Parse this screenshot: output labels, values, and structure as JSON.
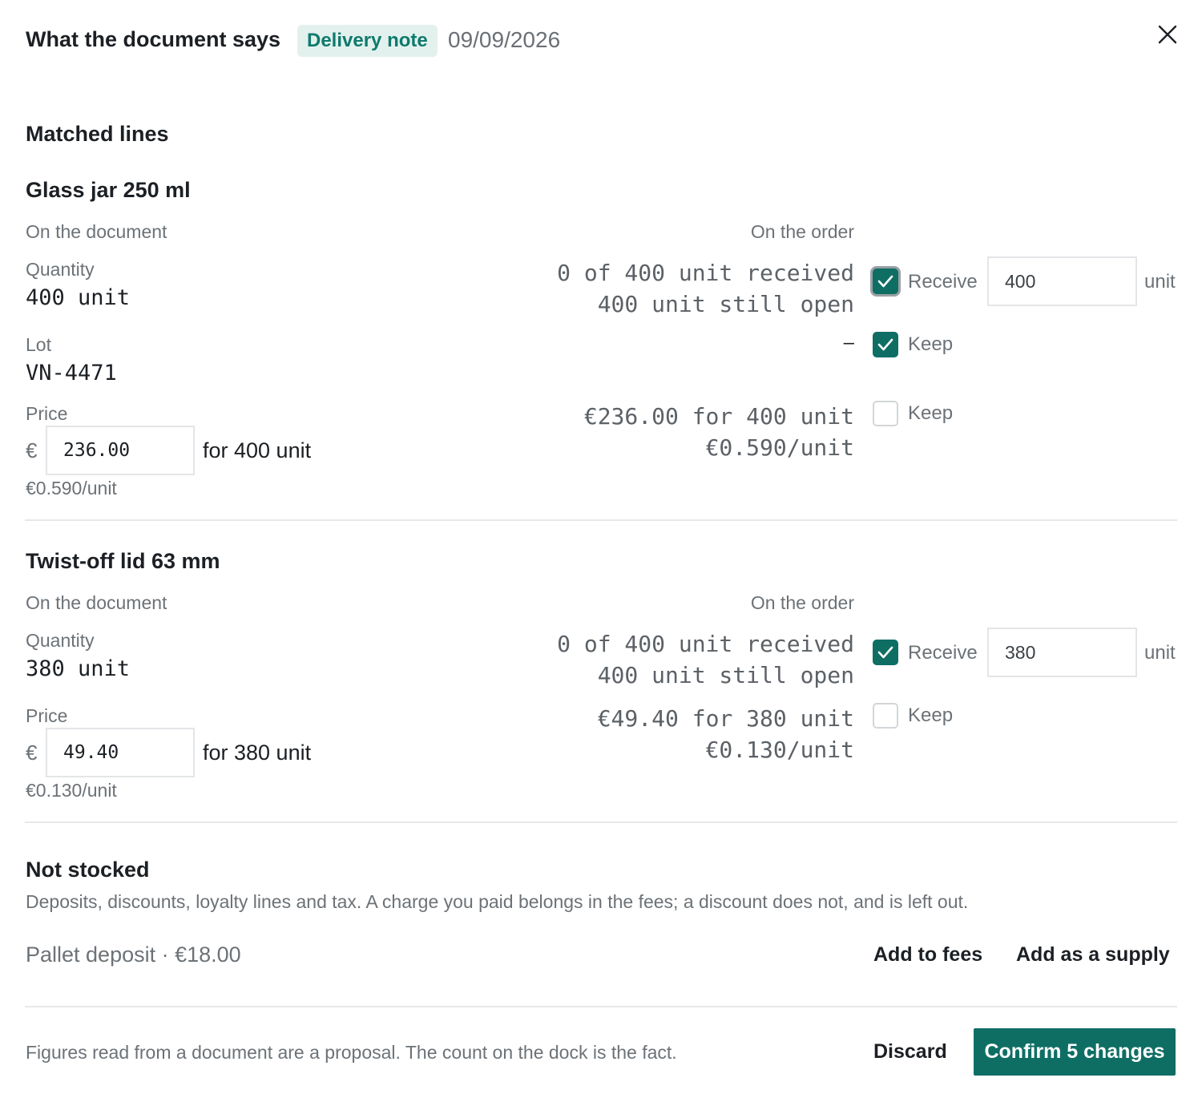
{
  "header": {
    "title": "What the document says",
    "badge": "Delivery note",
    "date": "09/09/2026"
  },
  "matched": {
    "heading": "Matched lines",
    "items": [
      {
        "name": "Glass jar 250 ml",
        "doc_label": "On the document",
        "order_label": "On the order",
        "quantity_label": "Quantity",
        "quantity_value": "400 unit",
        "order_received": "0 of 400 unit received",
        "order_open": "400 unit still open",
        "receive_label": "Receive",
        "receive_value": "400",
        "receive_unit": "unit",
        "receive_checked": true,
        "lot_label": "Lot",
        "lot_value": "VN-4471",
        "lot_order": "–",
        "lot_keep_label": "Keep",
        "lot_keep_checked": true,
        "price_label": "Price",
        "currency": "€",
        "price_value": "236.00",
        "price_for": "for 400 unit",
        "price_per_unit": "€0.590/unit",
        "order_price": "€236.00 for 400 unit",
        "order_price_unit": "€0.590/unit",
        "price_keep_label": "Keep",
        "price_keep_checked": false
      },
      {
        "name": "Twist-off lid 63 mm",
        "doc_label": "On the document",
        "order_label": "On the order",
        "quantity_label": "Quantity",
        "quantity_value": "380 unit",
        "order_received": "0 of 400 unit received",
        "order_open": "400 unit still open",
        "receive_label": "Receive",
        "receive_value": "380",
        "receive_unit": "unit",
        "receive_checked": true,
        "price_label": "Price",
        "currency": "€",
        "price_value": "49.40",
        "price_for": "for 380 unit",
        "price_per_unit": "€0.130/unit",
        "order_price": "€49.40 for 380 unit",
        "order_price_unit": "€0.130/unit",
        "price_keep_label": "Keep",
        "price_keep_checked": false
      }
    ]
  },
  "not_stocked": {
    "heading": "Not stocked",
    "description": "Deposits, discounts, loyalty lines and tax. A charge you paid belongs in the fees; a discount does not, and is left out.",
    "line": "Pallet deposit · €18.00",
    "add_fees": "Add to fees",
    "add_supply": "Add as a supply"
  },
  "footer": {
    "note": "Figures read from a document are a proposal. The count on the dock is the fact.",
    "discard": "Discard",
    "confirm": "Confirm 5 changes"
  },
  "icons": {
    "close": "close-icon",
    "check": "check-icon"
  },
  "colors": {
    "accent": "#0f6e64",
    "badge_bg": "#e3f1ee",
    "badge_text": "#0f7a6c"
  }
}
